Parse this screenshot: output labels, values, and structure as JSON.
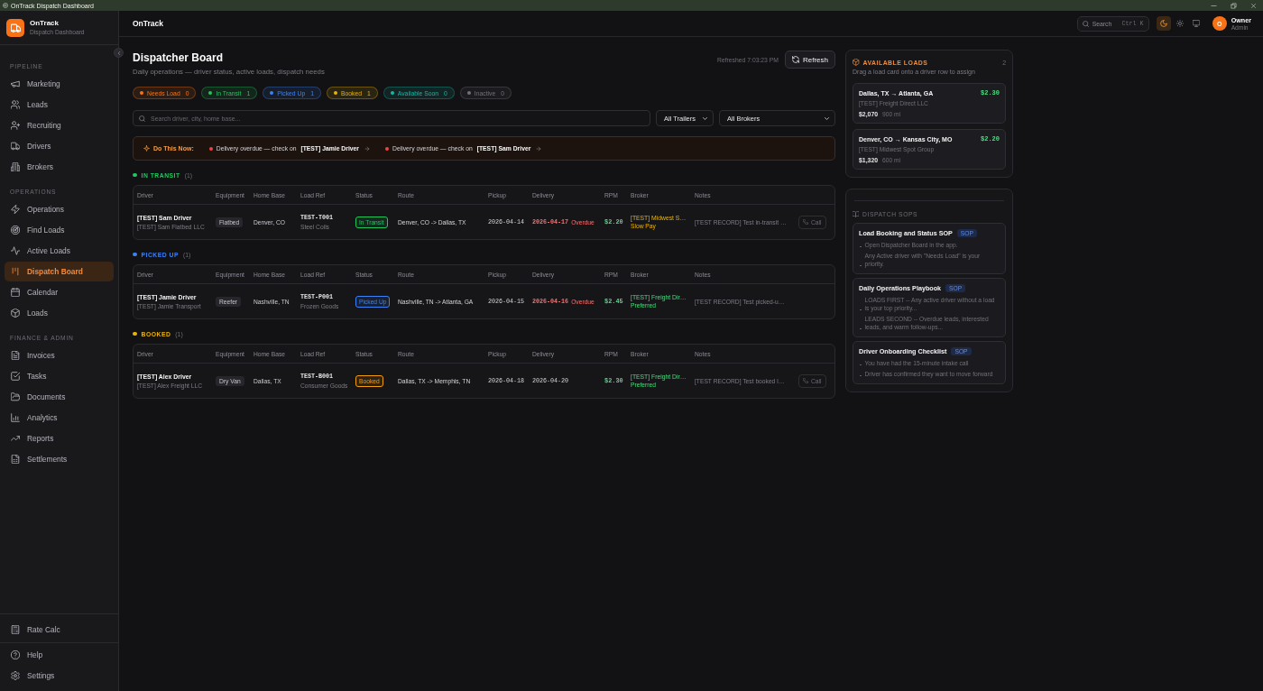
{
  "window": {
    "title": "OnTrack Dispatch Dashboard"
  },
  "sidebar": {
    "brand": {
      "name": "OnTrack",
      "subtitle": "Dispatch Dashboard"
    },
    "sections": [
      {
        "label": "PIPELINE",
        "items": [
          {
            "label": "Marketing",
            "selected": false
          },
          {
            "label": "Leads",
            "selected": false
          },
          {
            "label": "Recruiting",
            "selected": false
          },
          {
            "label": "Drivers",
            "selected": false
          },
          {
            "label": "Brokers",
            "selected": false
          }
        ]
      },
      {
        "label": "OPERATIONS",
        "items": [
          {
            "label": "Operations",
            "selected": false
          },
          {
            "label": "Find Loads",
            "selected": false
          },
          {
            "label": "Active Loads",
            "selected": false
          },
          {
            "label": "Dispatch Board",
            "selected": true
          },
          {
            "label": "Calendar",
            "selected": false
          },
          {
            "label": "Loads",
            "selected": false
          }
        ]
      },
      {
        "label": "FINANCE & ADMIN",
        "items": [
          {
            "label": "Invoices",
            "selected": false
          },
          {
            "label": "Tasks",
            "selected": false
          },
          {
            "label": "Documents",
            "selected": false
          },
          {
            "label": "Analytics",
            "selected": false
          },
          {
            "label": "Reports",
            "selected": false
          },
          {
            "label": "Settlements",
            "selected": false
          }
        ]
      }
    ],
    "footer": [
      [
        {
          "label": "Rate Calc",
          "selected": false
        }
      ],
      [
        {
          "label": "Help",
          "selected": false
        },
        {
          "label": "Settings",
          "selected": false
        }
      ]
    ]
  },
  "header": {
    "title": "OnTrack",
    "search": {
      "label": "Search",
      "shortcut": "Ctrl K"
    },
    "theme_options": [
      {
        "selected": true
      },
      {
        "selected": false
      },
      {
        "selected": false
      }
    ],
    "user": {
      "initial": "O",
      "name": "Owner",
      "role": "Admin"
    }
  },
  "board": {
    "title": "Dispatcher Board",
    "subtitle": "Daily operations — driver status, active loads, dispatch needs",
    "refreshed": "Refreshed 7:03:23 PM",
    "refresh_button": "Refresh",
    "filters": [
      {
        "label": "Needs Load",
        "count": "0",
        "color": "#f97316"
      },
      {
        "label": "In Transit",
        "count": "1",
        "color": "#22c55e"
      },
      {
        "label": "Picked Up",
        "count": "1",
        "color": "#3b82f6"
      },
      {
        "label": "Booked",
        "count": "1",
        "color": "#eab308"
      },
      {
        "label": "Available Soon",
        "count": "0",
        "color": "#14b8a6"
      },
      {
        "label": "Inactive",
        "count": "0",
        "color": "#71717a"
      }
    ],
    "search": {
      "placeholder": "Search driver, city, home base..."
    },
    "selects": [
      "All Trailers",
      "All Brokers"
    ],
    "alert": {
      "title": "Do This Now:",
      "items": [
        "Delivery overdue — check on **[TEST] Jamie Driver**",
        "Delivery overdue — check on **[TEST] Sam Driver**"
      ]
    },
    "sections": [
      {
        "title": "IN TRANSIT",
        "count": "(1)",
        "color": "#22c55e",
        "columns": [
          "Driver",
          "Equipment",
          "Home Base",
          "Load Ref",
          "Status",
          "Route",
          "Pickup",
          "Delivery",
          "RPM",
          "Broker",
          "Notes"
        ],
        "rows": [
          {
            "driver": "[TEST] Sam Driver",
            "company": "[TEST] Sam Flatbed LLC",
            "equipment": "Flatbed",
            "home_base": "Denver, CO",
            "load_ref": "TEST-T001",
            "commodity": "Steel Coils",
            "status": {
              "label": "In Transit",
              "color": "#22c55e"
            },
            "route": "Denver, CO -> Dallas, TX",
            "pickup": "2026-04-14",
            "delivery": "2026-04-17",
            "overdue": true,
            "overdue_label": "Overdue",
            "rpm": "$2.20",
            "broker": {
              "name": "[TEST] Midwest S…",
              "note": "Slow Pay",
              "kind": "warning"
            },
            "notes": "[TEST RECORD] Test in-transit …",
            "action": "Call"
          }
        ]
      },
      {
        "title": "PICKED UP",
        "count": "(1)",
        "color": "#3b82f6",
        "columns": [
          "Driver",
          "Equipment",
          "Home Base",
          "Load Ref",
          "Status",
          "Route",
          "Pickup",
          "Delivery",
          "RPM",
          "Broker",
          "Notes"
        ],
        "rows": [
          {
            "driver": "[TEST] Jamie Driver",
            "company": "[TEST] Jamie Transport",
            "equipment": "Reefer",
            "home_base": "Nashville, TN",
            "load_ref": "TEST-P001",
            "commodity": "Frozen Goods",
            "status": {
              "label": "Picked Up",
              "color": "#3b82f6"
            },
            "route": "Nashville, TN -> Atlanta, GA",
            "pickup": "2026-04-15",
            "delivery": "2026-04-16",
            "overdue": true,
            "overdue_label": "Overdue",
            "rpm": "$2.45",
            "broker": {
              "name": "[TEST] Freight Dir…",
              "note": "Preferred",
              "kind": "preferred"
            },
            "notes": "[TEST RECORD] Test picked-u…"
          }
        ]
      },
      {
        "title": "BOOKED",
        "count": "(1)",
        "color": "#eab308",
        "columns": [
          "Driver",
          "Equipment",
          "Home Base",
          "Load Ref",
          "Status",
          "Route",
          "Pickup",
          "Delivery",
          "RPM",
          "Broker",
          "Notes"
        ],
        "rows": [
          {
            "driver": "[TEST] Alex Driver",
            "company": "[TEST] Alex Freight LLC",
            "equipment": "Dry Van",
            "home_base": "Dallas, TX",
            "load_ref": "TEST-B001",
            "commodity": "Consumer Goods",
            "status": {
              "label": "Booked",
              "color": "#f59e0b"
            },
            "route": "Dallas, TX -> Memphis, TN",
            "pickup": "2026-04-18",
            "delivery": "2026-04-20",
            "overdue": false,
            "rpm": "$2.30",
            "broker": {
              "name": "[TEST] Freight Dir…",
              "note": "Preferred",
              "kind": "preferred"
            },
            "notes": "[TEST RECORD] Test booked l…",
            "action": "Call"
          }
        ]
      }
    ]
  },
  "available_loads": {
    "title": "AVAILABLE LOADS",
    "count": "2",
    "hint": "Drag a load card onto a driver row to assign",
    "loads": [
      {
        "route": "Dallas, TX → Atlanta, GA",
        "rpm": "$2.30",
        "broker": "[TEST] Freight Direct LLC",
        "rate": "$2,070",
        "miles": "900 mi"
      },
      {
        "route": "Denver, CO → Kansas City, MO",
        "rpm": "$2.20",
        "broker": "[TEST] Midwest Spot Group",
        "rate": "$1,320",
        "miles": "600 mi"
      }
    ]
  },
  "sops": {
    "title": "DISPATCH SOPS",
    "items": [
      {
        "title": "Load Booking and Status SOP",
        "badge": "SOP",
        "steps": [
          "Open Dispatcher Board in the app.",
          "Any Active driver with \"Needs Load\" is your priority."
        ]
      },
      {
        "title": "Daily Operations Playbook",
        "badge": "SOP",
        "steps": [
          "LOADS FIRST -- Any active driver without a load is your top priority...",
          "LEADS SECOND -- Overdue leads, interested leads, and warm follow-ups..."
        ]
      },
      {
        "title": "Driver Onboarding Checklist",
        "badge": "SOP",
        "steps": [
          "You have had the 15-minute intake call",
          "Driver has confirmed they want to move forward"
        ]
      }
    ]
  }
}
